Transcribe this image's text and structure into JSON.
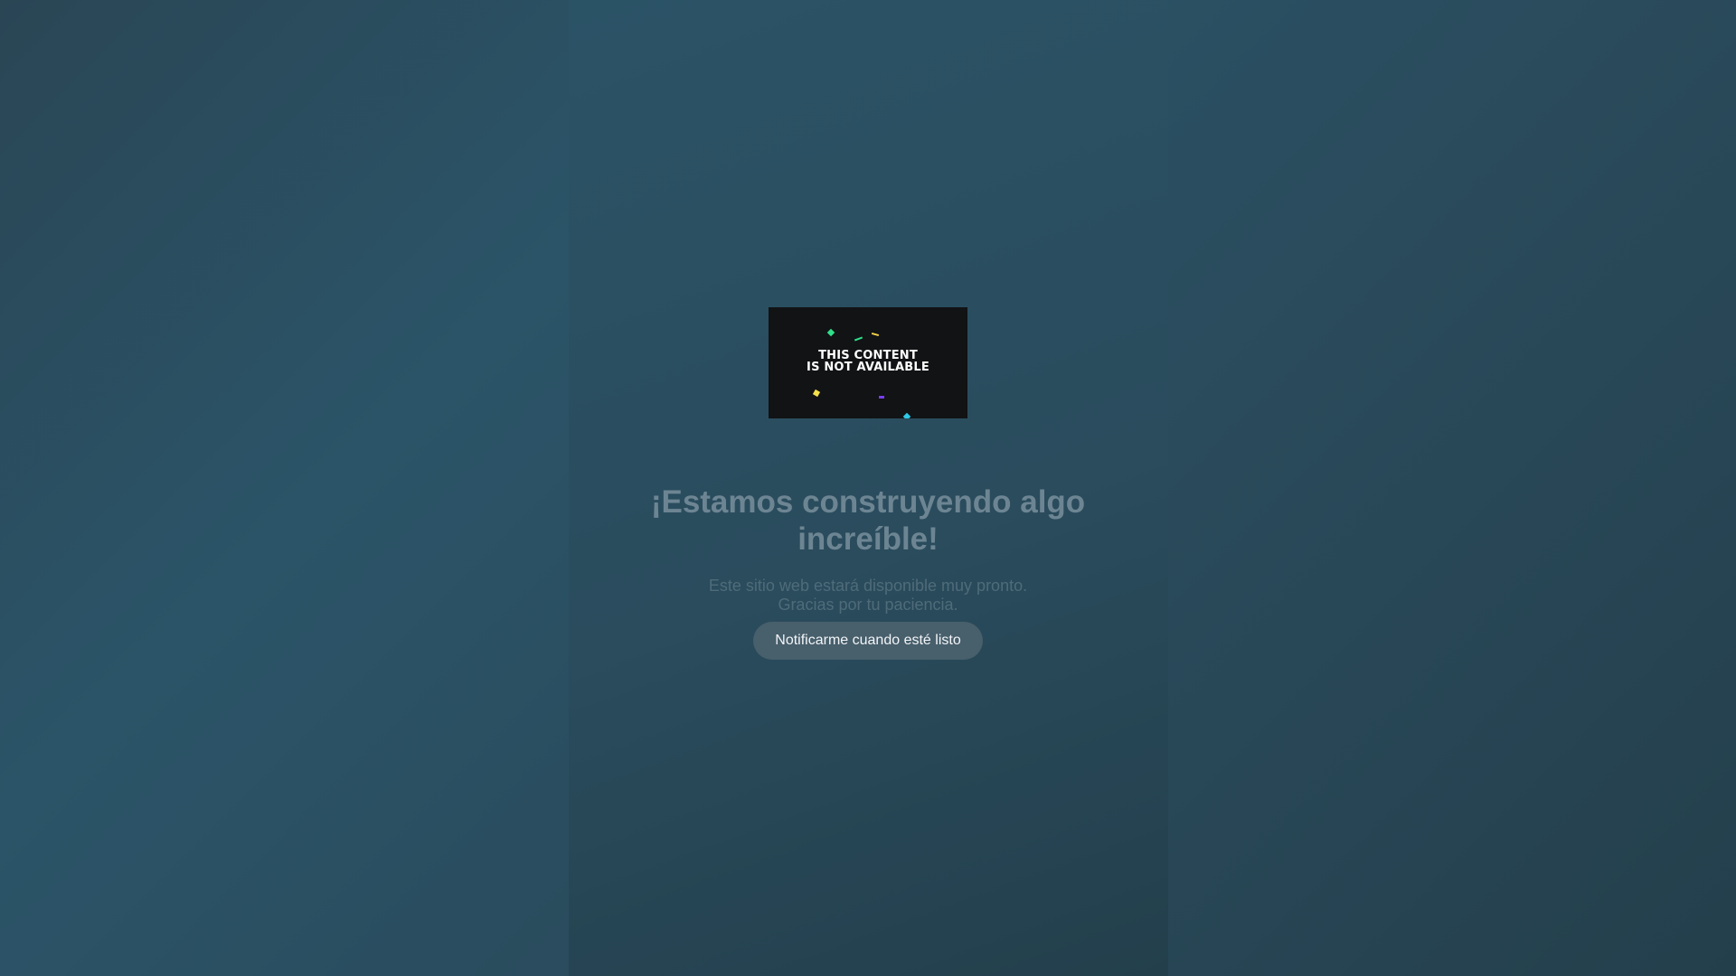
{
  "hero": {
    "image_text_line1": "THIS CONTENT",
    "image_text_line2": "IS NOT AVAILABLE"
  },
  "main": {
    "title": "¡Estamos construyendo algo increíble!",
    "subtitle_line1": "Este sitio web estará disponible muy pronto.",
    "subtitle_line2": "Gracias por tu paciencia.",
    "notify_button_label": "Notificarme cuando esté listo"
  },
  "colors": {
    "background": "#2a4b5c",
    "title": "#6d8593",
    "subtitle": "#4f6b79",
    "button": "#485f6c",
    "hero_background": "#111315"
  }
}
